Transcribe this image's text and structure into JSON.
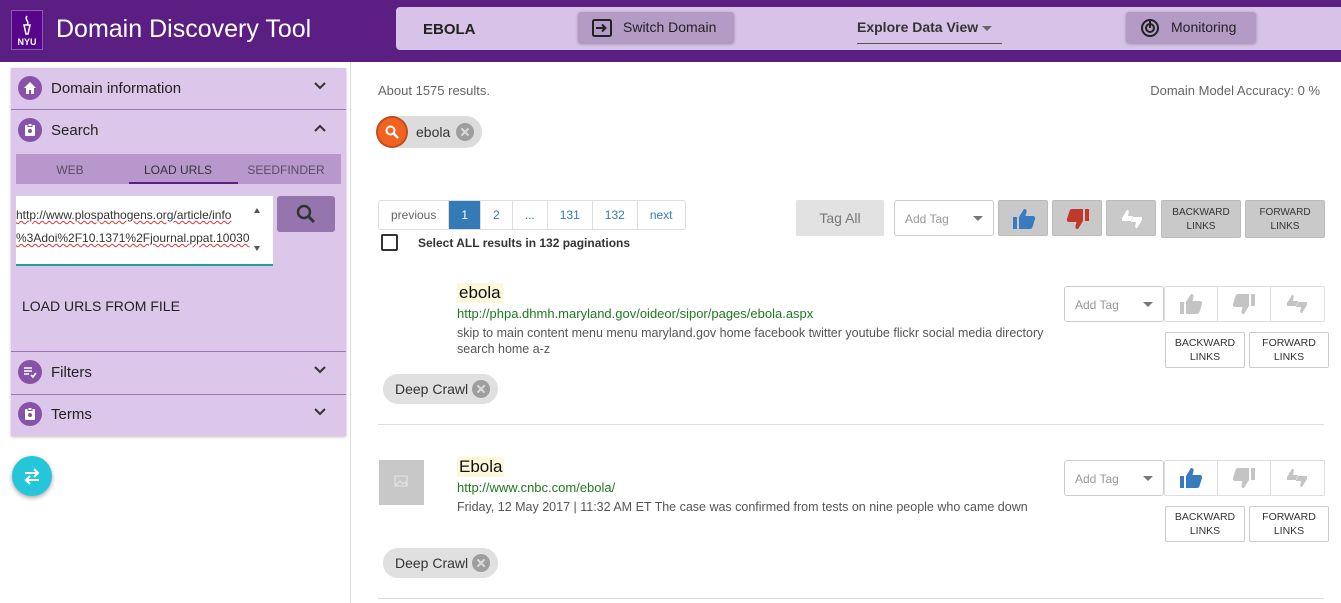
{
  "header": {
    "logo_text": "NYU",
    "app_title": "Domain Discovery Tool",
    "domain_name": "EBOLA",
    "switch_domain_label": "Switch Domain",
    "explore_view_label": "Explore Data View",
    "monitoring_label": "Monitoring",
    "icons": [
      "nyu-torch-logo",
      "switch-domain-icon",
      "chevron-down-icon",
      "monitoring-icon"
    ]
  },
  "sidebar": {
    "sections": [
      {
        "label": "Domain information",
        "icon": "home-icon",
        "state": "collapsed"
      },
      {
        "label": "Search",
        "icon": "search-section-icon",
        "state": "expanded"
      },
      {
        "label": "Filters",
        "icon": "filter-list-icon",
        "state": "collapsed"
      },
      {
        "label": "Terms",
        "icon": "terms-icon",
        "state": "collapsed"
      }
    ],
    "search_tabs": [
      "WEB",
      "LOAD URLS",
      "SEEDFINDER"
    ],
    "active_tab": "LOAD URLS",
    "url_input_lines": [
      "http://www.plospathogens.org/article/info",
      "%3Adoi%2F10.1371%2Fjournal.ppat.10030"
    ],
    "load_from_file_label": "LOAD URLS FROM FILE"
  },
  "main": {
    "results_count": "About 1575 results.",
    "accuracy": "Domain Model Accuracy: 0 %",
    "search_chip": "ebola",
    "pagination": {
      "previous": "previous",
      "pages": [
        "1",
        "2",
        "...",
        "131",
        "132"
      ],
      "current": "1",
      "next": "next"
    },
    "select_all_label": "Select ALL results in 132 paginations",
    "tag_all_label": "Tag All",
    "add_tag_placeholder": "Add Tag",
    "backward_links_label": "BACKWARD LINKS",
    "forward_links_label": "FORWARD LINKS",
    "results": [
      {
        "title": "ebola",
        "url": "http://phpa.dhmh.maryland.gov/oideor/sipor/pages/ebola.aspx",
        "snippet": "skip to main content   menu   menu maryland.gov home facebook twitter youtube flickr social media directory search home a-z",
        "tag": "Deep Crawl",
        "relevance": "none"
      },
      {
        "title": "Ebola",
        "url": "http://www.cnbc.com/ebola/",
        "snippet": "Friday, 12 May 2017 | 11:32 AM ET The case was confirmed from tests on nine people who came down",
        "tag": "Deep Crawl",
        "relevance": "relevant"
      }
    ]
  },
  "colors": {
    "header_purple": "#5b1f84",
    "sidebar_lilac": "#dcc6e9",
    "relevant_blue": "#3a7bbf",
    "irrelevant_red": "#c0392b",
    "fab_cyan": "#26c6da",
    "search_orange": "#f26322"
  }
}
